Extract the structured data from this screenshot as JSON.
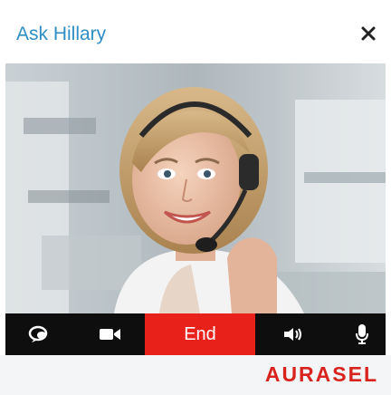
{
  "widget": {
    "title": "Ask Hillary",
    "close_icon": "close-icon"
  },
  "controls": {
    "chat_icon": "chat-bubble-icon",
    "camera_icon": "video-camera-icon",
    "end_label": "End",
    "volume_icon": "speaker-volume-icon",
    "mic_icon": "microphone-icon"
  },
  "footer": {
    "brand": "AURASEL"
  },
  "colors": {
    "title": "#2f8fc4",
    "end_button": "#e8211b",
    "brand": "#d8231f",
    "control_bar": "#0e0e0e"
  }
}
